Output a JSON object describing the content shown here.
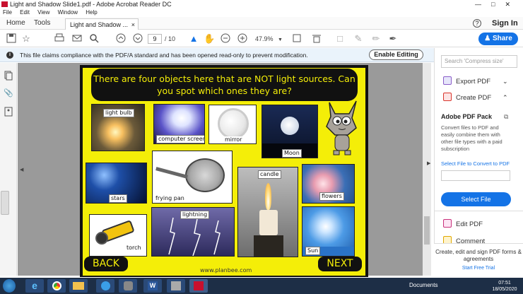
{
  "window": {
    "title": "Light and Shadow Slide1.pdf - Adobe Acrobat Reader DC",
    "controls": [
      "—",
      "□",
      "✕"
    ]
  },
  "menu": [
    "File",
    "Edit",
    "View",
    "Window",
    "Help"
  ],
  "tabs": {
    "home": "Home",
    "tools": "Tools",
    "document": "Light and Shadow ...",
    "close": "×",
    "help": "?",
    "sign_in": "Sign In"
  },
  "toolbar": {
    "page_current": "9",
    "page_total": "/ 10",
    "zoom": "47.9%",
    "share": "Share"
  },
  "notice": {
    "text": "This file claims compliance with the PDF/A standard and has been opened read-only to prevent modification.",
    "button": "Enable Editing"
  },
  "slide": {
    "question": "There are four objects here that are NOT light sources. Can you spot which ones they are?",
    "labels": {
      "light_bulb": "light bulb",
      "computer_screen": "computer screen",
      "mirror": "mirror",
      "moon": "Moon",
      "stars": "stars",
      "frying_pan": "frying pan",
      "candle": "candle",
      "flowers": "flowers",
      "lightning": "lightning",
      "torch": "torch",
      "sun": "Sun"
    },
    "back": "BACK",
    "next": "NEXT",
    "site": "www.planbee.com"
  },
  "right_panel": {
    "search_placeholder": "Search 'Compress size'",
    "export_pdf": "Export PDF",
    "create_pdf": "Create PDF",
    "pack_title": "Adobe PDF Pack",
    "pack_desc": "Convert files to PDF and easily combine them with other file types with a paid subscription",
    "select_link": "Select File to Convert to PDF",
    "select_button": "Select File",
    "edit_pdf": "Edit PDF",
    "comment": "Comment",
    "promo": "Create, edit and sign PDF forms & agreements",
    "trial": "Start Free Trial"
  },
  "taskbar": {
    "tray_label": "Documents",
    "time": "07:51",
    "date": "18/05/2020"
  },
  "colors": {
    "accent": "#1473e6",
    "slide_yellow": "#f4ee08",
    "taskbar": "#1d2e46"
  }
}
